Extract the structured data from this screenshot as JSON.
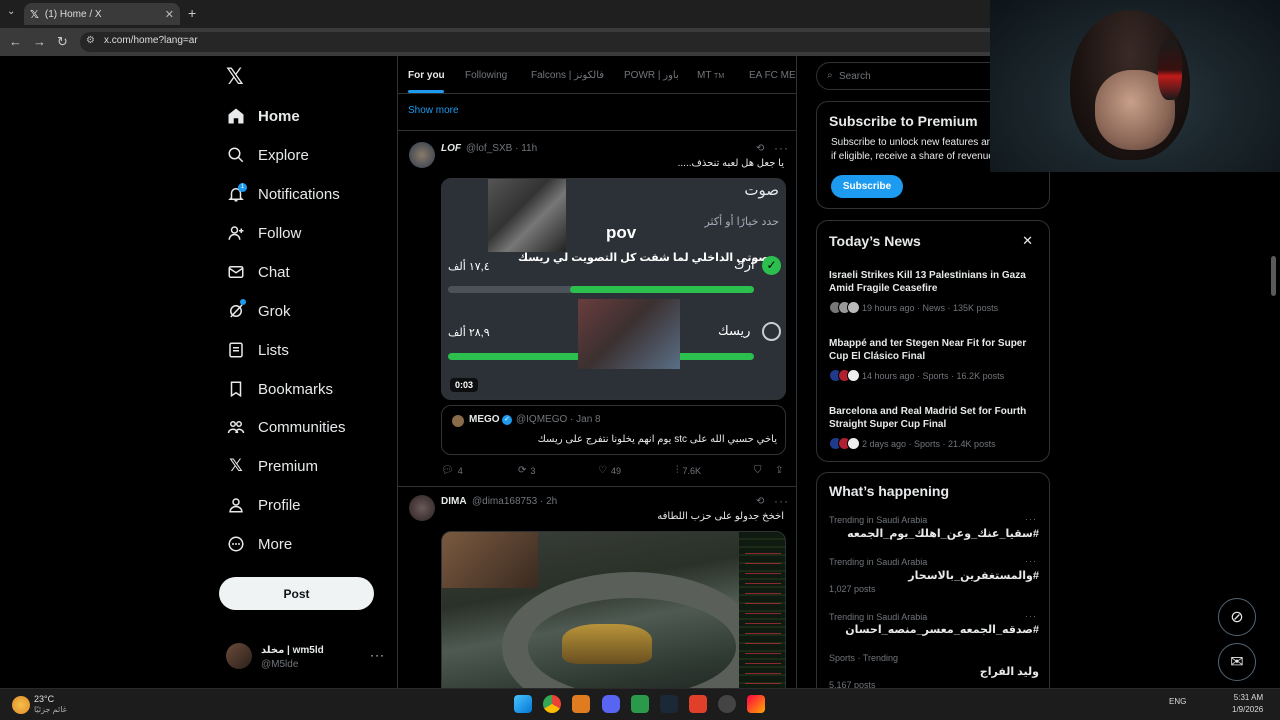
{
  "browser": {
    "tab_title": "(1) Home / X",
    "url": "x.com/home?lang=ar"
  },
  "sidebar": {
    "items": [
      {
        "label": "Home",
        "icon": "home-icon"
      },
      {
        "label": "Explore",
        "icon": "search-icon"
      },
      {
        "label": "Notifications",
        "icon": "bell-icon"
      },
      {
        "label": "Follow",
        "icon": "follow-icon"
      },
      {
        "label": "Chat",
        "icon": "mail-icon"
      },
      {
        "label": "Grok",
        "icon": "grok-icon"
      },
      {
        "label": "Lists",
        "icon": "list-icon"
      },
      {
        "label": "Bookmarks",
        "icon": "bookmark-icon"
      },
      {
        "label": "Communities",
        "icon": "communities-icon"
      },
      {
        "label": "Premium",
        "icon": "x-icon"
      },
      {
        "label": "Profile",
        "icon": "person-icon"
      },
      {
        "label": "More",
        "icon": "more-icon"
      }
    ],
    "notification_badge": "1",
    "post_label": "Post",
    "profile": {
      "name": "مخلد | wm5ld",
      "handle": "@M5lde"
    }
  },
  "feed_tabs": [
    {
      "label": "For you",
      "active": true
    },
    {
      "label": "Following"
    },
    {
      "label": "Falcons | فالكونز"
    },
    {
      "label": "POWR | باور"
    },
    {
      "label": "MT"
    },
    {
      "label": "EA FC MEN"
    }
  ],
  "mt_tag": "TM",
  "show_more": "Show more",
  "tweet1": {
    "name": "LOF",
    "handle": "@lof_SXB",
    "time": "11h",
    "text": "يا جعل هل لعبه تنحذف.....",
    "poll": {
      "title": "صوت",
      "subtitle": "حدد خيارًا أو أكثر",
      "pov": "pov",
      "question": "صوتي الداخلي لما شفت كل التصويت لي ريسك",
      "options": [
        {
          "label": "ارك",
          "count": "١٧,٤ ألف",
          "fraction": 0.6
        },
        {
          "label": "ريسك",
          "count": "٢٨,٩ ألف",
          "fraction": 1.0
        }
      ],
      "timer": "0:03"
    },
    "quote": {
      "name": "MEGO",
      "handle": "@IQMEGO · Jan 8",
      "text": "ياخي حسبي الله على stc يوم انهم يخلونا نتفرج على ريسك"
    },
    "actions": {
      "replies": "4",
      "reposts": "3",
      "likes": "49",
      "views": "7.6K"
    }
  },
  "tweet2": {
    "name": "DIMA",
    "handle": "@dima168753",
    "time": "2h",
    "text": "اخخخ جدولو على حزب اللطافه"
  },
  "right": {
    "search_placeholder": "Search",
    "premium": {
      "title": "Subscribe to Premium",
      "desc": "Subscribe to unlock new features and if eligible, receive a share of revenue.",
      "button": "Subscribe"
    },
    "news": {
      "title": "Today’s News",
      "items": [
        {
          "title": "Israeli Strikes Kill 13 Palestinians in Gaza Amid Fragile Ceasefire",
          "meta": "19 hours ago · News · 135K posts"
        },
        {
          "title": "Mbappé and ter Stegen Near Fit for Super Cup El Clásico Final",
          "meta": "14 hours ago · Sports · 16.2K posts"
        },
        {
          "title": "Barcelona and Real Madrid Set for Fourth Straight Super Cup Final",
          "meta": "2 days ago · Sports · 21.4K posts"
        }
      ]
    },
    "happening": {
      "title": "What’s happening",
      "items": [
        {
          "meta": "Trending in Saudi Arabia",
          "tag": "#سقيا_عنك_وعن_اهلك_يوم_الجمعه"
        },
        {
          "meta": "Trending in Saudi Arabia",
          "tag": "#والمستغفرين_بالاسحار",
          "posts": "1,027 posts"
        },
        {
          "meta": "Trending in Saudi Arabia",
          "tag": "#صدقه_الجمعه_معسر_منصه_احسان"
        },
        {
          "meta": "Sports · Trending",
          "tag": "وليد الفراج",
          "posts": "5,167 posts"
        }
      ]
    }
  },
  "taskbar": {
    "temp": "23°C",
    "weather_desc": "غائم جزئيًا",
    "lang": "ENG",
    "time": "5:31 AM",
    "date": "1/9/2026"
  },
  "colors": {
    "accent": "#1d9bf0",
    "poll_green": "#2bbf4d"
  }
}
